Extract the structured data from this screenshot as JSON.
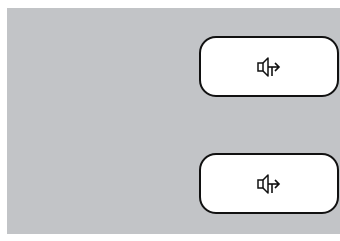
{
  "screen": {
    "background": "#ffffff",
    "panel_color": "#c2c4c7"
  },
  "buttons": [
    {
      "name": "audio-output-button-1",
      "icon": "speaker-output-icon"
    },
    {
      "name": "audio-output-button-2",
      "icon": "speaker-output-icon"
    }
  ],
  "colors": {
    "button_fill": "#ffffff",
    "button_border": "#111111",
    "icon": "#111111"
  }
}
